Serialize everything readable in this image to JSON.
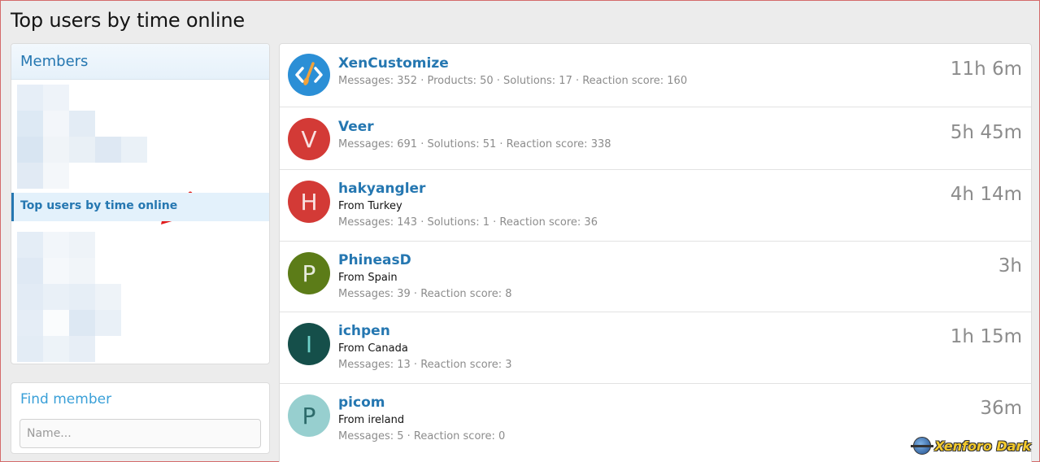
{
  "page": {
    "title": "Top users by time online"
  },
  "sidebar": {
    "members_header": "Members",
    "selected_nav": "Top users by time online",
    "find_header": "Find member",
    "find_placeholder": "Name..."
  },
  "users": [
    {
      "name": "XenCustomize",
      "initial": "",
      "location": "",
      "stats": "Messages: 352 · Products: 50 · Solutions: 17 · Reaction score: 160",
      "time": "11h 6m",
      "avatar_color": "#2b8fd6"
    },
    {
      "name": "Veer",
      "initial": "V",
      "location": "",
      "stats": "Messages: 691 · Solutions: 51 · Reaction score: 338",
      "time": "5h 45m",
      "avatar_color": "#d33a36"
    },
    {
      "name": "hakyangler",
      "initial": "H",
      "location": "From Turkey",
      "stats": "Messages: 143 · Solutions: 1 · Reaction score: 36",
      "time": "4h 14m",
      "avatar_color": "#d33a36"
    },
    {
      "name": "PhineasD",
      "initial": "P",
      "location": "From Spain",
      "stats": "Messages: 39 · Reaction score: 8",
      "time": "3h",
      "avatar_color": "#5c7c18"
    },
    {
      "name": "ichpen",
      "initial": "I",
      "location": "From Canada",
      "stats": "Messages: 13 · Reaction score: 3",
      "time": "1h 15m",
      "avatar_color": "#154f4a"
    },
    {
      "name": "picom",
      "initial": "P",
      "location": "From ireland",
      "stats": "Messages: 5 · Reaction score: 0",
      "time": "36m",
      "avatar_color": "#97cfcf"
    }
  ],
  "watermark": "Xenforo Dark",
  "colors": {
    "accent": "#2577b1",
    "muted": "#8c8c8c",
    "arrow": "#e11c1c"
  }
}
